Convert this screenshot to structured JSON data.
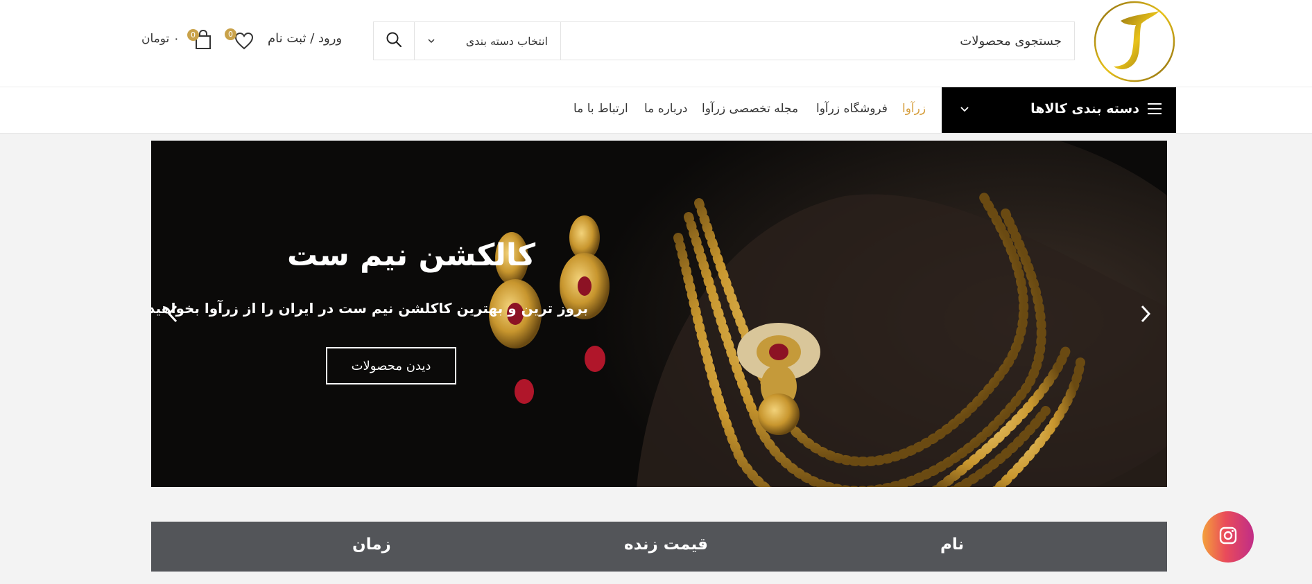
{
  "header": {
    "search": {
      "placeholder": "جستجوی محصولات",
      "category_label": "انتخاب دسته بندی"
    },
    "login_label": "ورود / ثبت نام",
    "wishlist_count": "0",
    "cart_count": "0",
    "cart_total": "۰ تومان"
  },
  "nav": {
    "category_menu_label": "دسته بندی کالاها",
    "links": [
      "زرآوا",
      "فروشگاه زرآوا",
      "مجله تخصصی زرآوا",
      "درباره ما",
      "ارتباط با ما"
    ],
    "active_link": "زرآوا"
  },
  "slider": {
    "title": "کالکشن نیم ست",
    "subtitle": "بروز ترین و بهترین کاکلشن نیم ست در ایران را از زرآوا بخواهید",
    "button_label": "دیدن محصولات"
  },
  "table": {
    "headers": [
      "نام",
      "قیمت زنده",
      "زمان"
    ]
  },
  "colors": {
    "accent": "#d59d3b",
    "table_header": "#535559",
    "category_menu": "#000000"
  },
  "icons": [
    "logo-icon",
    "search-icon",
    "heart-icon",
    "cart-icon",
    "menu-icon",
    "chevron-down-icon",
    "chevron-left-icon",
    "chevron-right-icon",
    "instagram-icon"
  ]
}
